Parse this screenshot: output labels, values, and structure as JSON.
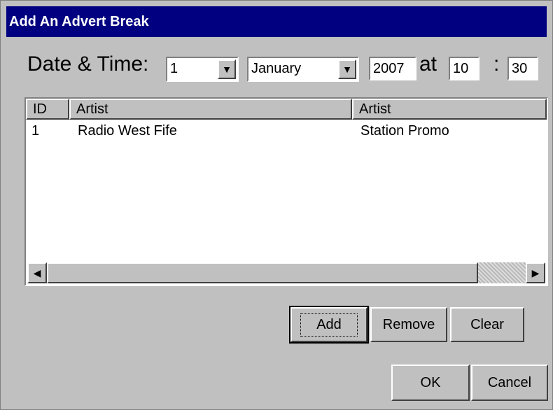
{
  "dialog": {
    "title": "Add An Advert Break"
  },
  "datetime": {
    "label": "Date & Time:",
    "day": "1",
    "month": "January",
    "year": "2007",
    "at_label": "at",
    "hour": "10",
    "colon": ":",
    "minute": "30"
  },
  "list": {
    "columns": [
      "ID",
      "Artist",
      "Artist"
    ],
    "rows": [
      {
        "id": "1",
        "artist": "Radio West Fife",
        "title": "Station Promo"
      }
    ]
  },
  "buttons": {
    "add": "Add",
    "remove": "Remove",
    "clear": "Clear",
    "ok": "OK",
    "cancel": "Cancel"
  },
  "icons": {
    "dropdown": "chevron-down-icon",
    "scroll_left": "arrow-left-icon",
    "scroll_right": "arrow-right-icon"
  }
}
